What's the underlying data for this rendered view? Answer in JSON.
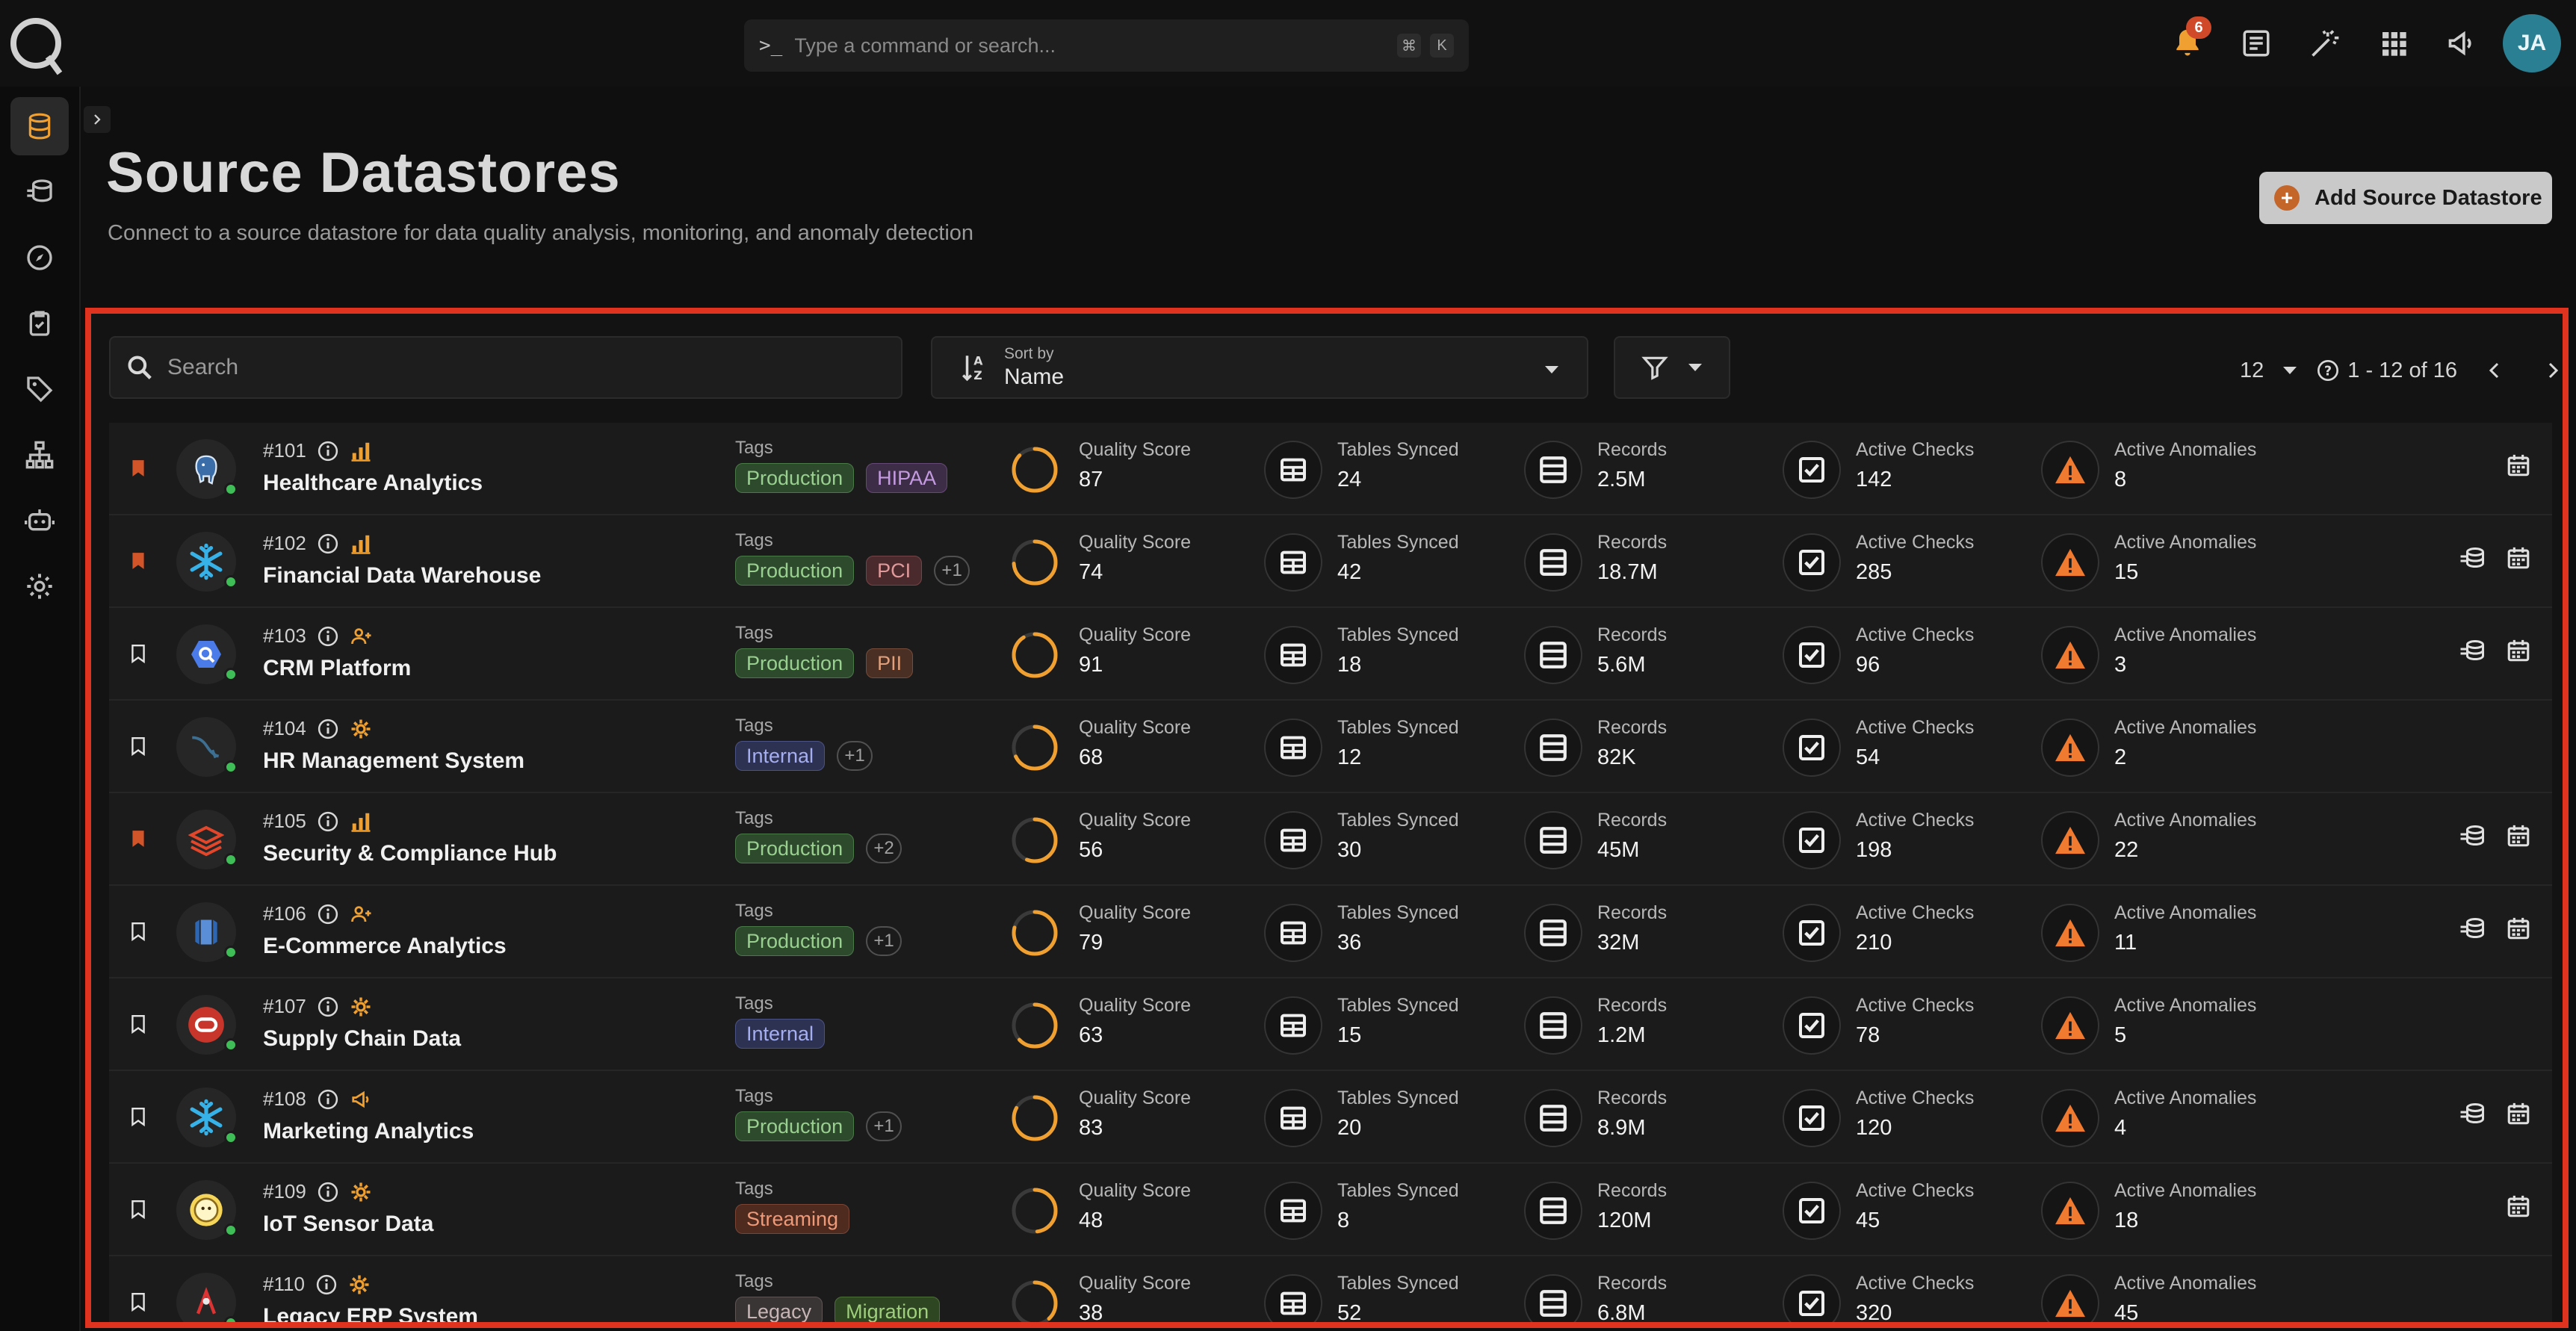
{
  "command": {
    "prompt": ">_",
    "placeholder": "Type a command or search...",
    "keys": [
      "⌘",
      "K"
    ]
  },
  "topbar": {
    "notifications_count": "6",
    "avatar_initials": "JA"
  },
  "header": {
    "title": "Source Datastores",
    "subtitle": "Connect to a source datastore for data quality analysis, monitoring, and anomaly detection",
    "add_button_label": "Add Source Datastore"
  },
  "toolbar": {
    "search_placeholder": "Search",
    "sort_by_label": "Sort by",
    "sort_by_value": "Name",
    "page_size": "12",
    "page_range": "1 - 12 of 16"
  },
  "metric_labels": {
    "tags": "Tags",
    "quality": "Quality Score",
    "tables": "Tables Synced",
    "records": "Records",
    "checks": "Active Checks",
    "anomalies": "Active Anomalies"
  },
  "colors": {
    "accent": "#e0331f",
    "orange": "#f0a030",
    "status_ok": "#3fbe58"
  },
  "datastores": [
    {
      "id": "#101",
      "name": "Healthcare Analytics",
      "bookmarked": true,
      "type_icon": "postgres-icon",
      "badge_icon": "bar-chart-icon",
      "tags": [
        {
          "label": "Production",
          "cls": "t-prod"
        },
        {
          "label": "HIPAA",
          "cls": "t-hipaa"
        }
      ],
      "more": "",
      "quality": "87",
      "quality_pct": 0.87,
      "tables": "24",
      "records": "2.5M",
      "checks": "142",
      "anomalies": "8",
      "actions": [
        "calendar"
      ]
    },
    {
      "id": "#102",
      "name": "Financial Data Warehouse",
      "bookmarked": true,
      "type_icon": "snowflake-icon",
      "badge_icon": "bar-chart-icon",
      "tags": [
        {
          "label": "Production",
          "cls": "t-prod"
        },
        {
          "label": "PCI",
          "cls": "t-pci"
        }
      ],
      "more": "+1",
      "quality": "74",
      "quality_pct": 0.74,
      "tables": "42",
      "records": "18.7M",
      "checks": "285",
      "anomalies": "15",
      "actions": [
        "sync",
        "calendar"
      ]
    },
    {
      "id": "#103",
      "name": "CRM Platform",
      "bookmarked": false,
      "type_icon": "bigquery-icon",
      "badge_icon": "user-group-icon",
      "tags": [
        {
          "label": "Production",
          "cls": "t-prod"
        },
        {
          "label": "PII",
          "cls": "t-pii"
        }
      ],
      "more": "",
      "quality": "91",
      "quality_pct": 0.91,
      "tables": "18",
      "records": "5.6M",
      "checks": "96",
      "anomalies": "3",
      "actions": [
        "sync",
        "calendar"
      ]
    },
    {
      "id": "#104",
      "name": "HR Management System",
      "bookmarked": false,
      "type_icon": "mysql-icon",
      "badge_icon": "gear-icon",
      "tags": [
        {
          "label": "Internal",
          "cls": "t-int"
        }
      ],
      "more": "+1",
      "quality": "68",
      "quality_pct": 0.68,
      "tables": "12",
      "records": "82K",
      "checks": "54",
      "anomalies": "2",
      "actions": []
    },
    {
      "id": "#105",
      "name": "Security & Compliance Hub",
      "bookmarked": true,
      "type_icon": "databricks-icon",
      "badge_icon": "bar-chart-icon",
      "tags": [
        {
          "label": "Production",
          "cls": "t-prod"
        }
      ],
      "more": "+2",
      "quality": "56",
      "quality_pct": 0.56,
      "tables": "30",
      "records": "45M",
      "checks": "198",
      "anomalies": "22",
      "actions": [
        "sync",
        "calendar"
      ]
    },
    {
      "id": "#106",
      "name": "E-Commerce Analytics",
      "bookmarked": false,
      "type_icon": "redshift-icon",
      "badge_icon": "user-group-icon",
      "tags": [
        {
          "label": "Production",
          "cls": "t-prod"
        }
      ],
      "more": "+1",
      "quality": "79",
      "quality_pct": 0.79,
      "tables": "36",
      "records": "32M",
      "checks": "210",
      "anomalies": "11",
      "actions": [
        "sync",
        "calendar"
      ]
    },
    {
      "id": "#107",
      "name": "Supply Chain Data",
      "bookmarked": false,
      "type_icon": "oracle-icon",
      "badge_icon": "gear-icon",
      "tags": [
        {
          "label": "Internal",
          "cls": "t-int"
        }
      ],
      "more": "",
      "quality": "63",
      "quality_pct": 0.63,
      "tables": "15",
      "records": "1.2M",
      "checks": "78",
      "anomalies": "5",
      "actions": []
    },
    {
      "id": "#108",
      "name": "Marketing Analytics",
      "bookmarked": false,
      "type_icon": "snowflake-icon",
      "badge_icon": "megaphone-icon",
      "tags": [
        {
          "label": "Production",
          "cls": "t-prod"
        }
      ],
      "more": "+1",
      "quality": "83",
      "quality_pct": 0.83,
      "tables": "20",
      "records": "8.9M",
      "checks": "120",
      "anomalies": "4",
      "actions": [
        "sync",
        "calendar"
      ]
    },
    {
      "id": "#109",
      "name": "IoT Sensor Data",
      "bookmarked": false,
      "type_icon": "hive-icon",
      "badge_icon": "gear-icon",
      "tags": [
        {
          "label": "Streaming",
          "cls": "t-stream"
        }
      ],
      "more": "",
      "quality": "48",
      "quality_pct": 0.48,
      "tables": "8",
      "records": "120M",
      "checks": "45",
      "anomalies": "18",
      "actions": [
        "calendar"
      ]
    },
    {
      "id": "#110",
      "name": "Legacy ERP System",
      "bookmarked": false,
      "type_icon": "db2-icon",
      "badge_icon": "gear-icon",
      "tags": [
        {
          "label": "Legacy",
          "cls": "t-legacy"
        },
        {
          "label": "Migration",
          "cls": "t-mig"
        }
      ],
      "more": "",
      "quality": "38",
      "quality_pct": 0.38,
      "tables": "52",
      "records": "6.8M",
      "checks": "320",
      "anomalies": "45",
      "actions": []
    }
  ]
}
